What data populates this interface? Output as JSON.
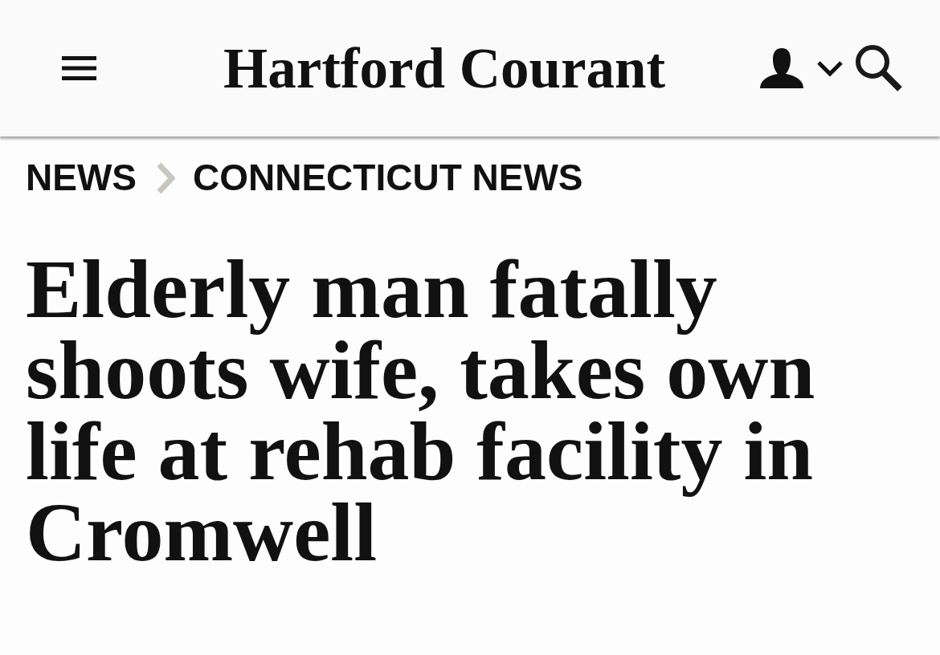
{
  "header": {
    "logo": "Hartford Courant"
  },
  "breadcrumb": [
    "NEWS",
    "CONNECTICUT NEWS"
  ],
  "headline": "Elderly man fatally shoots wife, takes own life at rehab facility in Cromwell"
}
